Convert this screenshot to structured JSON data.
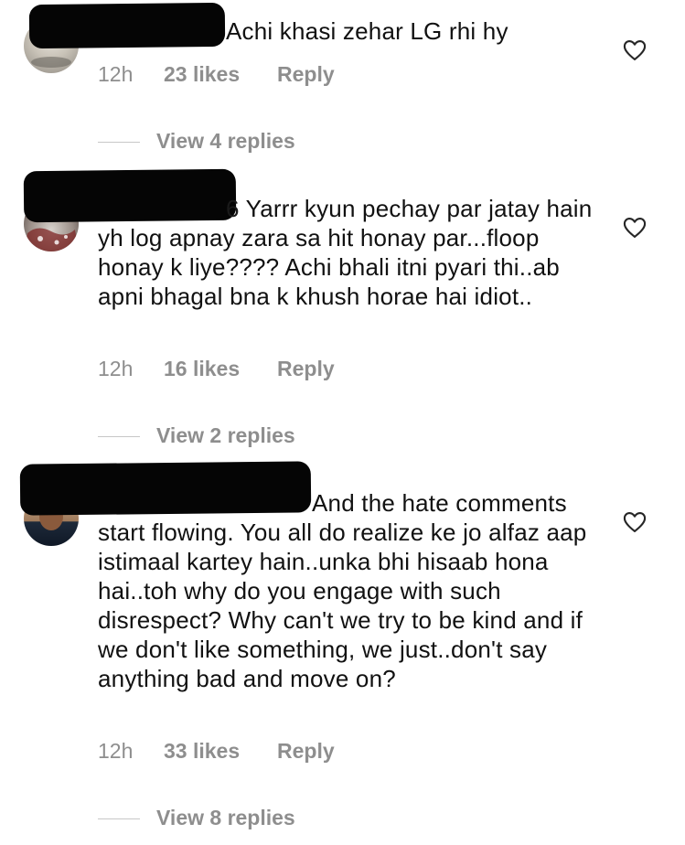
{
  "comments": [
    {
      "username": "",
      "text": "Achi khasi zehar LG rhi hy",
      "time": "12h",
      "likes": "23 likes",
      "reply": "Reply",
      "view_replies": "View 4 replies"
    },
    {
      "username": "6",
      "text": "Yarrr kyun pechay par jatay hain yh log apnay zara sa hit honay par...floop honay k liye???? Achi bhali itni pyari thi..ab apni bhagal bna k khush horae hai idiot..",
      "time": "12h",
      "likes": "16 likes",
      "reply": "Reply",
      "view_replies": "View 2 replies"
    },
    {
      "username": "",
      "text": "And the hate comments start flowing. You all do realize ke jo alfaz aap istimaal kartey hain..unka bhi hisaab hona hai..toh why do you engage with such disrespect? Why can't we try to be kind and if we don't like something, we just..don't say anything bad and move on?",
      "time": "12h",
      "likes": "33 likes",
      "reply": "Reply",
      "view_replies": "View 8 replies"
    }
  ],
  "icons": {
    "like": "heart-outline-icon"
  },
  "colors": {
    "text": "#111111",
    "meta": "#8e8e8e",
    "redaction": "#050505"
  }
}
